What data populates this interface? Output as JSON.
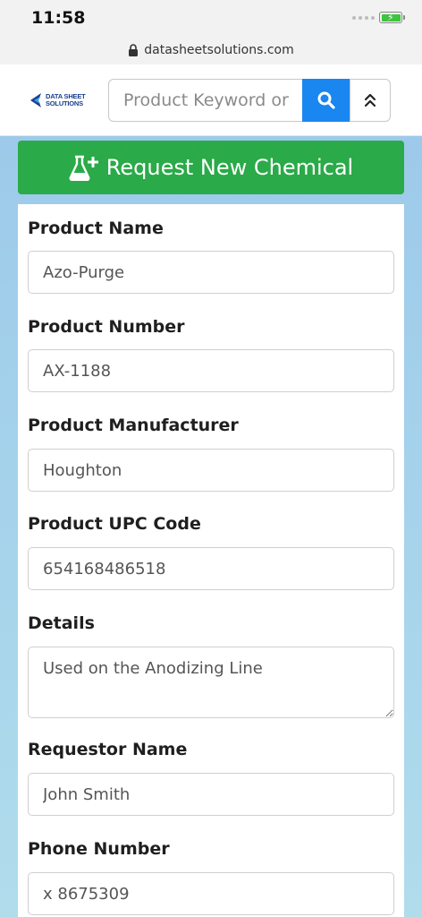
{
  "status_bar": {
    "time": "11:58"
  },
  "browser": {
    "url": "datasheetsolutions.com"
  },
  "header": {
    "logo_line1": "DATA SHEET",
    "logo_line2": "SOLUTIONS",
    "search_placeholder": "Product Keyword or",
    "accent_color": "#1a86f0"
  },
  "request_button": {
    "label": "Request New Chemical",
    "color": "#2aaa48"
  },
  "form": {
    "fields": [
      {
        "label": "Product Name",
        "value": "Azo-Purge"
      },
      {
        "label": "Product Number",
        "value": "AX-1188"
      },
      {
        "label": "Product Manufacturer",
        "value": "Houghton"
      },
      {
        "label": "Product UPC Code",
        "value": "654168486518"
      },
      {
        "label": "Details",
        "value": "Used on the Anodizing Line"
      },
      {
        "label": "Requestor Name",
        "value": "John Smith"
      },
      {
        "label": "Phone Number",
        "value": "x 8675309"
      }
    ]
  },
  "icons": {
    "lock": "lock-icon",
    "search": "search-icon",
    "collapse": "chevron-double-up-icon",
    "flask": "flask-plus-icon",
    "battery": "battery-charging-icon"
  }
}
